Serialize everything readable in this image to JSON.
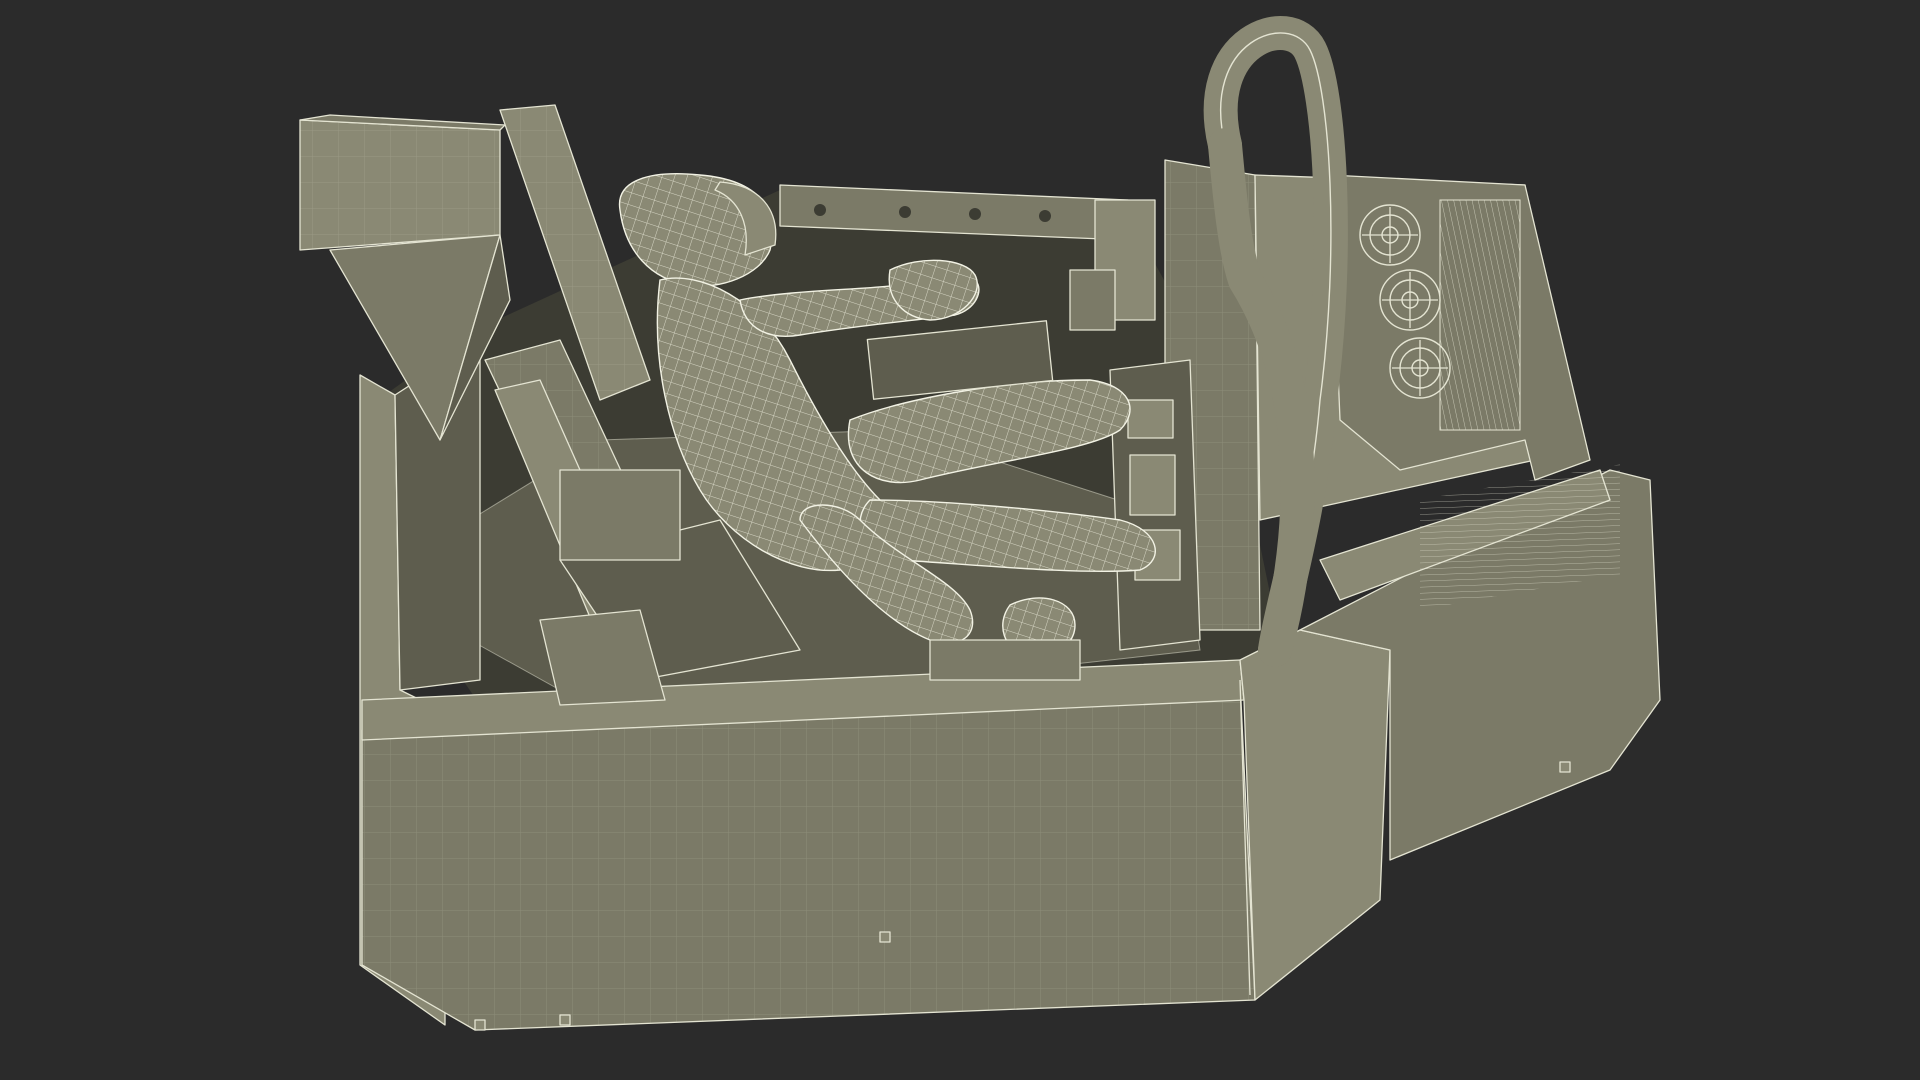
{
  "scene": {
    "subject": "wireframe-cockpit-simulator",
    "colors": {
      "background": "#2b2b2b",
      "body_fill": "#7b7a67",
      "body_fill_light": "#8a8974",
      "body_fill_dark": "#5e5d4e",
      "interior_shadow": "#3c3c33",
      "wire": "#e4e4d2",
      "wire_edge": "#f2f2e4"
    },
    "icons": [
      "fan-grille-icon",
      "fan-grille-icon",
      "fan-grille-icon"
    ]
  }
}
